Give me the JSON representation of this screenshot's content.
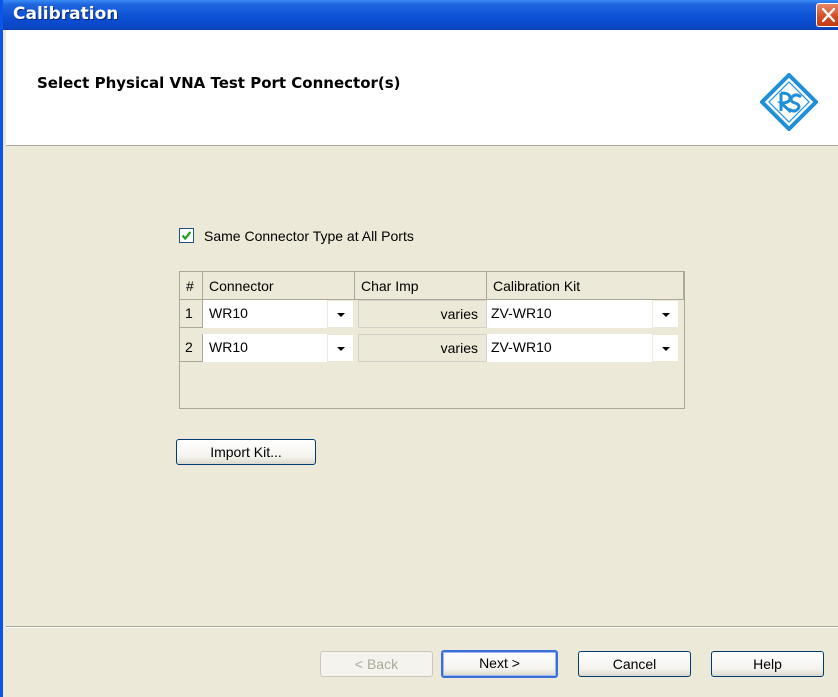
{
  "window": {
    "title": "Calibration"
  },
  "header": {
    "heading": "Select Physical VNA Test Port Connector(s)"
  },
  "options": {
    "same_connector_label": "Same Connector Type at All Ports",
    "same_connector_checked": true
  },
  "table": {
    "columns": [
      "#",
      "Connector",
      "Char Imp",
      "Calibration Kit"
    ],
    "rows": [
      {
        "num": "1",
        "connector": "WR10",
        "char_imp": "varies",
        "cal_kit": "ZV-WR10"
      },
      {
        "num": "2",
        "connector": "WR10",
        "char_imp": "varies",
        "cal_kit": "ZV-WR10"
      }
    ]
  },
  "buttons": {
    "import_kit": "Import Kit...",
    "back": "< Back",
    "next": "Next >",
    "cancel": "Cancel",
    "help": "Help"
  },
  "icons": {
    "close": "close-icon",
    "logo": "rs-logo-icon",
    "check": "checkmark-icon",
    "dropdown": "chevron-down-icon"
  },
  "colors": {
    "title_bar": "#0a48c4",
    "logo_blue": "#1e8fd8",
    "close_red": "#d24b22"
  }
}
